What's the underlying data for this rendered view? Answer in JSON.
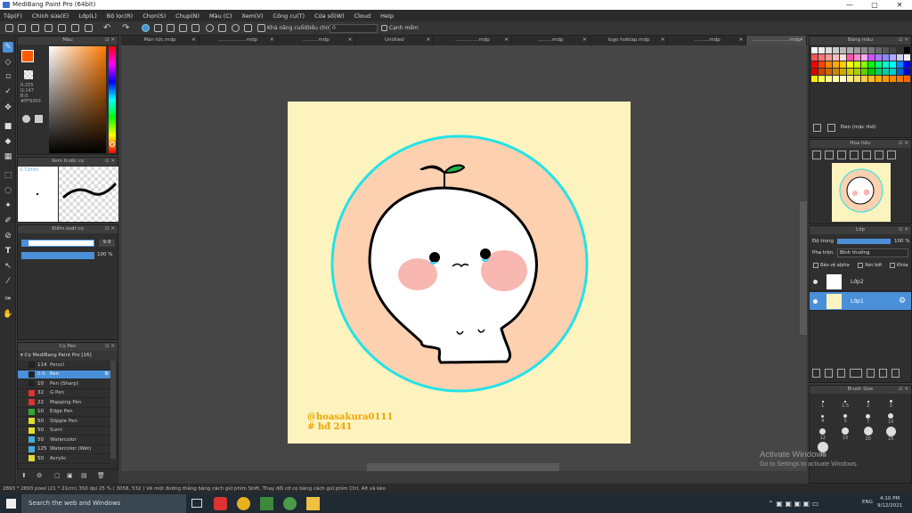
{
  "window": {
    "title": "MediBang Paint Pro (64bit)",
    "min": "—",
    "max": "▢",
    "close": "✕"
  },
  "menu": [
    "Tệp(F)",
    "Chỉnh sửa(E)",
    "Lớp(L)",
    "Bộ lọc(R)",
    "Chọn(S)",
    "Chụp(N)",
    "Màu (C)",
    "Xem(V)",
    "Công cụ(T)",
    "Cửa số(W)",
    "Cloud",
    "Help"
  ],
  "toolbar": {
    "correction_label": "Khả năng cuối",
    "adjust_label": "Điều chỉnh",
    "adjust_value": "0",
    "edge_label": "Cạnh mềm"
  },
  "tabs": [
    {
      "label": "Màn tức.mdp"
    },
    {
      "label": "..................mdp"
    },
    {
      "label": "..........mdp"
    },
    {
      "label": "Untitled"
    },
    {
      "label": "...............mdp"
    },
    {
      "label": ".........mdp"
    },
    {
      "label": "logo hoktap.mdp"
    },
    {
      "label": "..........mdp"
    },
    {
      "label": "........................mdp"
    }
  ],
  "color_panel": {
    "title": "Màu",
    "r": "R:255",
    "g": "G:147",
    "b": "B:0",
    "hex": "#FF9300"
  },
  "brush_preview": {
    "title": "Xem trước cọ",
    "size": "0.72mm"
  },
  "brush_control": {
    "title": "Kiểm soát cọ",
    "size_value": "9.9",
    "opacity_value": "100 %"
  },
  "brush_panel": {
    "title": "Cọ Pen",
    "group": "Cọ MediBang Paint Pro [16]",
    "items": [
      {
        "size": "114",
        "name": "Pencil",
        "color": "#222222"
      },
      {
        "size": "0.6",
        "name": "Pen",
        "color": "#222222",
        "selected": true
      },
      {
        "size": "10",
        "name": "Pen (Sharp)",
        "color": "#222222"
      },
      {
        "size": "32",
        "name": "G Pen",
        "color": "#d33"
      },
      {
        "size": "22",
        "name": "Mapping Pen",
        "color": "#d33"
      },
      {
        "size": "10",
        "name": "Edge Pen",
        "color": "#3a3"
      },
      {
        "size": "50",
        "name": "Stipple Pen",
        "color": "#dd3"
      },
      {
        "size": "50",
        "name": "Sumi",
        "color": "#dd3"
      },
      {
        "size": "50",
        "name": "Watercolor",
        "color": "#4ad"
      },
      {
        "size": "125",
        "name": "Watercolor (Wet)",
        "color": "#4ad"
      },
      {
        "size": "50",
        "name": "Acrylic",
        "color": "#dd3"
      }
    ]
  },
  "artwork": {
    "signature_1": "@hoasakura0111",
    "signature_2": "# hđ 241"
  },
  "palette": {
    "title": "Bảng màu",
    "current": "Đen (mặc thờ)"
  },
  "navigator": {
    "title": "Hoa tiêu"
  },
  "layers": {
    "title": "Lớp",
    "opacity_label": "Độ trong",
    "opacity_value": "100 %",
    "blend_label": "Pha trộn",
    "blend_value": "Bình thường",
    "alpha_label": "Bảo vệ alpha",
    "clip_label": "Xén bớt",
    "lock_label": "Khóa",
    "items": [
      {
        "name": "Lớp2"
      },
      {
        "name": "Lớp1",
        "selected": true
      }
    ]
  },
  "brush_size": {
    "title": "Brush Size",
    "labels": [
      "1",
      "1.5",
      "2",
      "3",
      "4",
      "5",
      "7",
      "10",
      "12",
      "15",
      "20",
      "25",
      "30"
    ]
  },
  "status": "2893 * 2893 pixel  (21 * 21cm)  350 dpi  25 %  ( 3058, 532 )  Vẽ một đường thẳng bằng cách giữ phím Shift, Thay đổi cỡ cọ bằng cách giữ phím Ctrl, Alt và kéo",
  "taskbar": {
    "search": "Search the web and Windows",
    "time": "4:10 PM",
    "date": "9/12/2021",
    "lang": "ENG"
  },
  "watermark": {
    "line1": "Activate Windows",
    "line2": "Go to Settings to activate Windows."
  }
}
